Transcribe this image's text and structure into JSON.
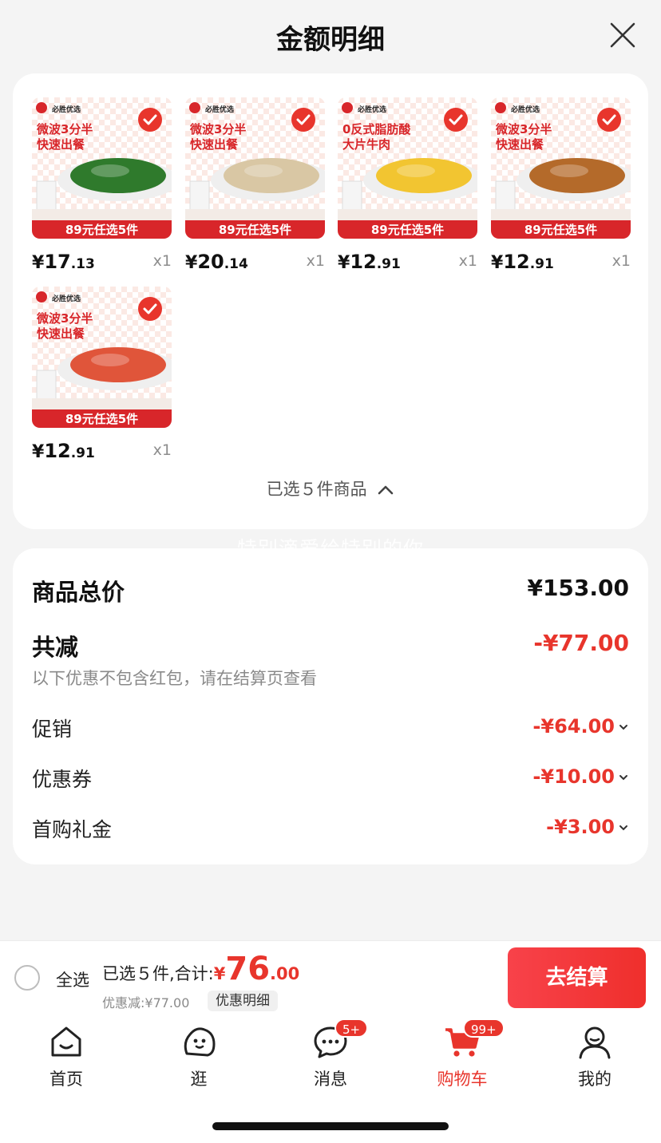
{
  "header": {
    "title": "金额明细"
  },
  "products": [
    {
      "brand": "必胜优选",
      "headline": "微波3分半\n快速出餐",
      "promo": "89元任选5件",
      "price_symbol": "¥",
      "price_int": "17",
      "price_dec": ".13",
      "qty": "x1",
      "sauce": "#2f7a2c"
    },
    {
      "brand": "必胜优选",
      "headline": "微波3分半\n快速出餐",
      "promo": "89元任选5件",
      "price_symbol": "¥",
      "price_int": "20",
      "price_dec": ".14",
      "qty": "x1",
      "sauce": "#d9c7a4"
    },
    {
      "brand": "必胜优选",
      "headline": "0反式脂肪酸\n大片牛肉",
      "promo": "89元任选5件",
      "price_symbol": "¥",
      "price_int": "12",
      "price_dec": ".91",
      "qty": "x1",
      "sauce": "#f2c531"
    },
    {
      "brand": "必胜优选",
      "headline": "微波3分半\n快速出餐",
      "promo": "89元任选5件",
      "price_symbol": "¥",
      "price_int": "12",
      "price_dec": ".91",
      "qty": "x1",
      "sauce": "#b46a2a"
    },
    {
      "brand": "必胜优选",
      "headline": "微波3分半\n快速出餐",
      "promo": "89元任选5件",
      "price_symbol": "¥",
      "price_int": "12",
      "price_dec": ".91",
      "qty": "x1",
      "sauce": "#e0553a"
    }
  ],
  "selection": {
    "toggle_label": "已选５件商品"
  },
  "watermark": "特别滴爱给特别的你",
  "summary": {
    "total_label": "商品总价",
    "total_value": "¥153.00",
    "reduce_label": "共减",
    "reduce_value": "-¥77.00",
    "note": "以下优惠不包含红包，请在结算页查看",
    "discounts": [
      {
        "label": "促销",
        "value": "-¥64.00"
      },
      {
        "label": "优惠券",
        "value": "-¥10.00"
      },
      {
        "label": "首购礼金",
        "value": "-¥3.00"
      }
    ]
  },
  "checkout": {
    "select_all": "全选",
    "summary_text": "已选５件,合计:",
    "total_symbol": "¥",
    "total_int": "76",
    "total_dec": ".00",
    "saved": "优惠减:¥77.00",
    "detail_chip": "优惠明细",
    "pay_button": "去结算"
  },
  "tabs": [
    {
      "label": "首页",
      "icon": "home-icon"
    },
    {
      "label": "逛",
      "icon": "browse-icon"
    },
    {
      "label": "消息",
      "icon": "message-icon",
      "badge": "5+"
    },
    {
      "label": "购物车",
      "icon": "cart-icon",
      "badge": "99+",
      "active": true
    },
    {
      "label": "我的",
      "icon": "profile-icon"
    }
  ],
  "colors": {
    "accent": "#e8352c",
    "card": "#ffffff",
    "background": "#f4f4f4"
  }
}
